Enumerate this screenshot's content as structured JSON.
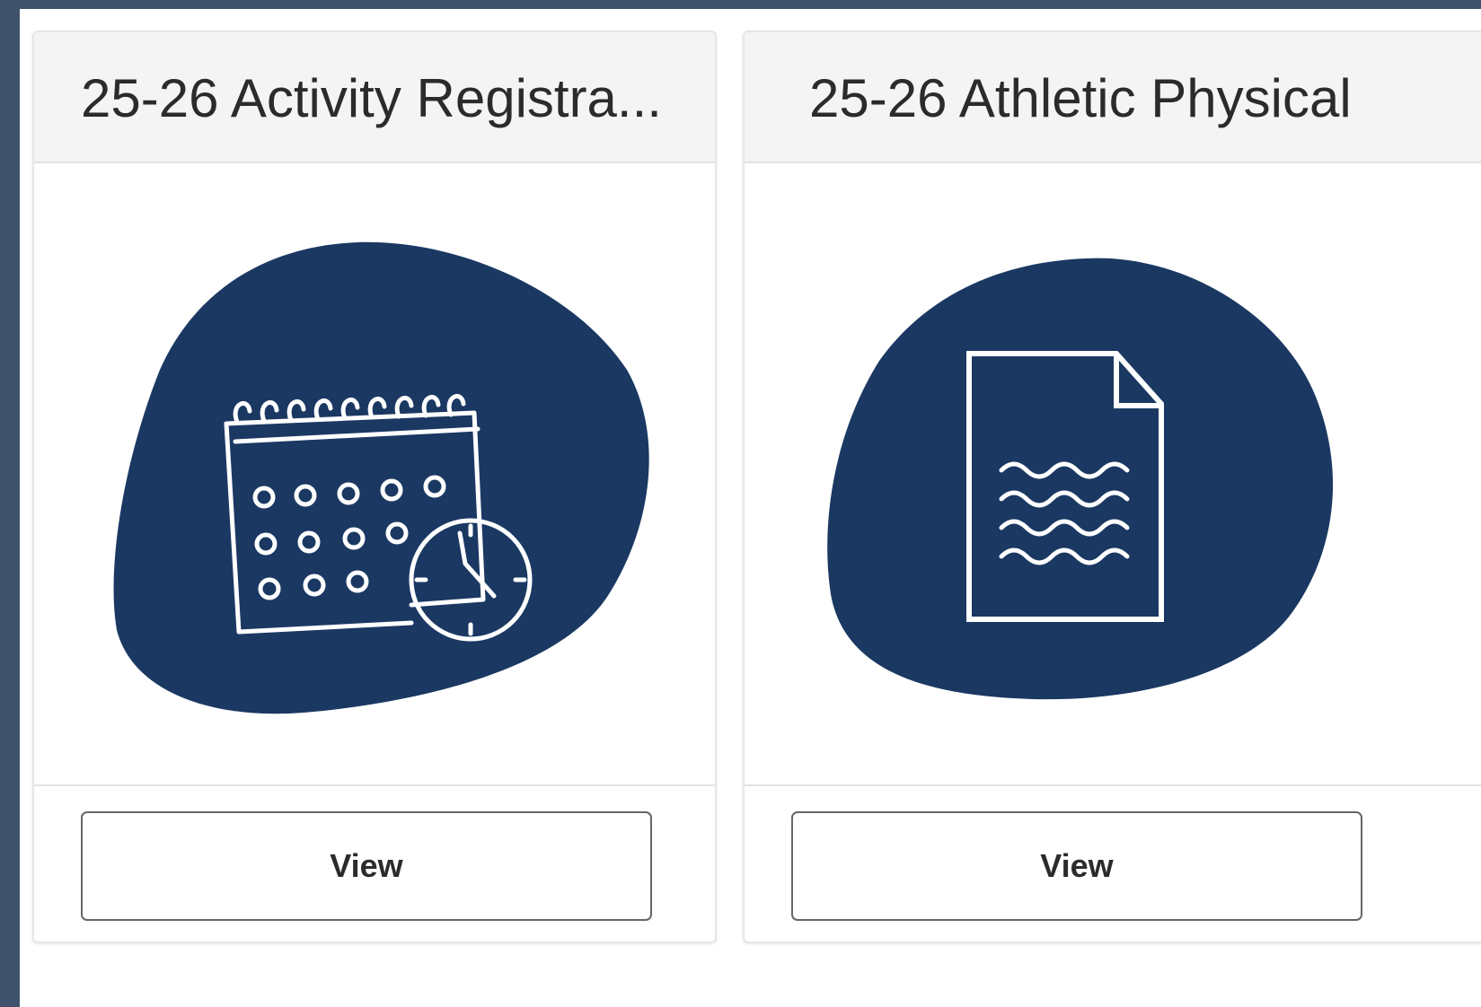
{
  "colors": {
    "frame": "#3e526c",
    "blob": "#1a3862",
    "header_bg": "#f4f4f4"
  },
  "cards": [
    {
      "title": "25-26 Activity Registra...",
      "icon": "calendar-clock-icon",
      "button_label": "View"
    },
    {
      "title": "25-26 Athletic Physical",
      "icon": "document-icon",
      "button_label": "View"
    }
  ]
}
